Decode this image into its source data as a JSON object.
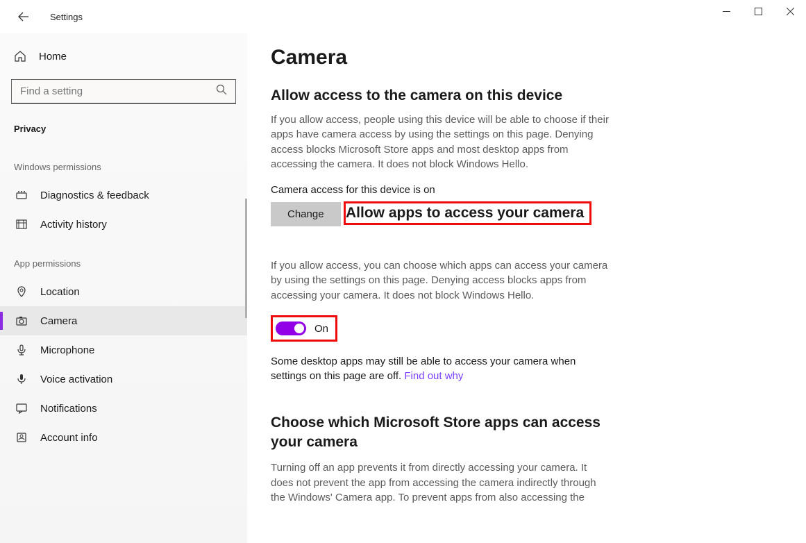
{
  "app": {
    "title": "Settings"
  },
  "sidebar": {
    "home_label": "Home",
    "search_placeholder": "Find a setting",
    "section_label": "Privacy",
    "group1_label": "Windows permissions",
    "group2_label": "App permissions",
    "items_group1": [
      {
        "label": "Diagnostics & feedback",
        "icon": "diagnostics"
      },
      {
        "label": "Activity history",
        "icon": "history"
      }
    ],
    "items_group2": [
      {
        "label": "Location",
        "icon": "location"
      },
      {
        "label": "Camera",
        "icon": "camera",
        "selected": true
      },
      {
        "label": "Microphone",
        "icon": "microphone"
      },
      {
        "label": "Voice activation",
        "icon": "voice"
      },
      {
        "label": "Notifications",
        "icon": "notifications"
      },
      {
        "label": "Account info",
        "icon": "account"
      }
    ]
  },
  "content": {
    "page_title": "Camera",
    "section1": {
      "heading": "Allow access to the camera on this device",
      "desc": "If you allow access, people using this device will be able to choose if their apps have camera access by using the settings on this page. Denying access blocks Microsoft Store apps and most desktop apps from accessing the camera. It does not block Windows Hello.",
      "status": "Camera access for this device is on",
      "change_label": "Change"
    },
    "section2": {
      "heading": "Allow apps to access your camera",
      "desc": "If you allow access, you can choose which apps can access your camera by using the settings on this page. Denying access blocks apps from accessing your camera. It does not block Windows Hello.",
      "toggle_state": "On",
      "note_prefix": "Some desktop apps may still be able to access your camera when settings on this page are off. ",
      "note_link": "Find out why"
    },
    "section3": {
      "heading": "Choose which Microsoft Store apps can access your camera",
      "desc": "Turning off an app prevents it from directly accessing your camera. It does not prevent the app from accessing the camera indirectly through the Windows' Camera app. To prevent apps from also accessing the"
    }
  }
}
